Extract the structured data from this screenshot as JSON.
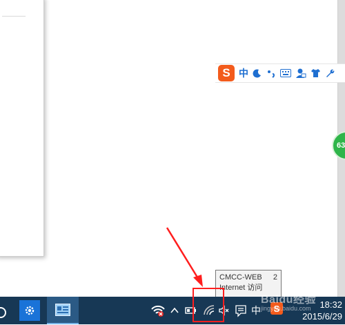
{
  "ime_toolbar": {
    "chinese_mode_label": "中",
    "logo_letter": "S"
  },
  "badge": {
    "value": "63"
  },
  "tooltip": {
    "network_name": "CMCC-WEB",
    "network_number": "2",
    "status": "Internet 访问"
  },
  "taskbar": {
    "ime_indicator": "中",
    "clock_time": "18:32",
    "clock_date": "2015/6/29"
  },
  "watermark": {
    "brand": "Baidu经验",
    "url": "jingyan.baidu.com"
  },
  "colors": {
    "taskbar_bg": "#173855",
    "accent_blue": "#1a73d8",
    "annotation_red": "#ff1e1e",
    "ime_orange": "#f35b1c"
  }
}
